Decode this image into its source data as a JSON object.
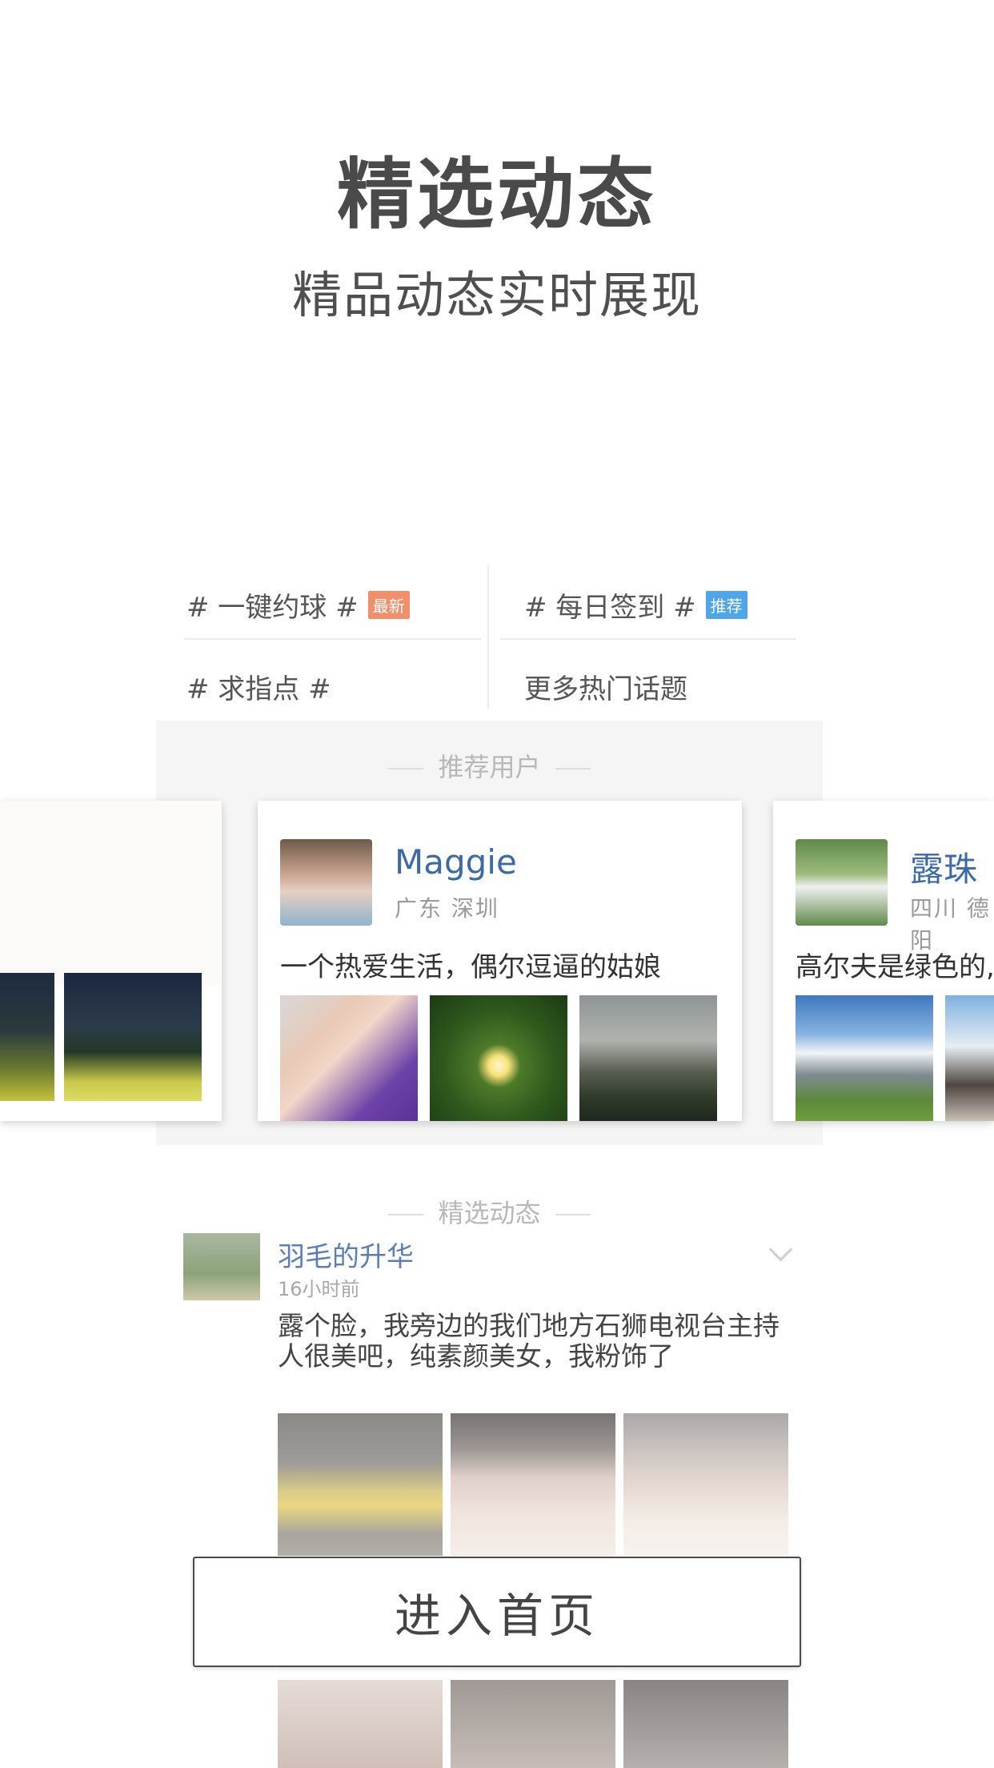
{
  "header": {
    "title": "精选动态",
    "subtitle": "精品动态实时展现"
  },
  "topics": [
    {
      "label": "# 一键约球 #",
      "tag": "最新",
      "tag_color": "#f08f6a"
    },
    {
      "label": "# 每日签到 #",
      "tag": "推荐",
      "tag_color": "#4ea6e6"
    },
    {
      "label": "# 求指点 #"
    },
    {
      "label": "更多热门话题"
    }
  ],
  "recommended_section": {
    "title": "推荐用户"
  },
  "users": [
    {
      "name": "Maggie",
      "location": "广东  深圳",
      "bio": "一个热爱生活，偶尔逗逼的姑娘"
    },
    {
      "name": "露珠",
      "location": "四川  德阳",
      "bio": "高尔夫是绿色的,"
    }
  ],
  "feed_section": {
    "title": "精选动态"
  },
  "post": {
    "user": "羽毛的升华",
    "time": "16小时前",
    "text": "露个脸，我旁边的我们地方石狮电视台主持人很美吧，纯素颜美女，我粉饰了"
  },
  "enter_button": {
    "label": "进入首页"
  },
  "colors": {
    "name_blue": "#3b6aa6",
    "tag_new": "#f08f6a",
    "tag_recommend": "#4ea6e6"
  }
}
